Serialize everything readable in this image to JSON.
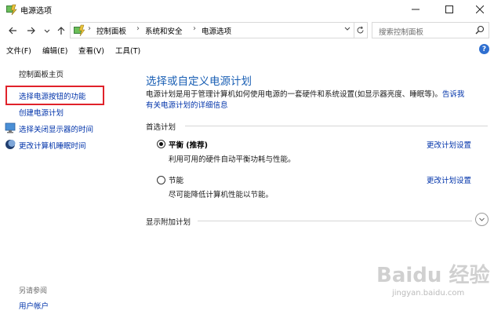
{
  "window": {
    "title": "电源选项",
    "controls": {
      "minimize": "minimize",
      "maximize": "maximize",
      "close": "close"
    }
  },
  "address": {
    "crumbs": [
      "控制面板",
      "系统和安全",
      "电源选项"
    ],
    "search_placeholder": "搜索控制面板"
  },
  "menubar": {
    "items": [
      "文件(F)",
      "编辑(E)",
      "查看(V)",
      "工具(T)"
    ]
  },
  "sidebar": {
    "home": "控制面板主页",
    "items": [
      {
        "label": "选择电源按钮的功能",
        "icon": "none",
        "highlighted": true
      },
      {
        "label": "创建电源计划",
        "icon": "none"
      },
      {
        "label": "选择关闭显示器的时间",
        "icon": "monitor-icon"
      },
      {
        "label": "更改计算机睡眠时间",
        "icon": "moon-icon"
      }
    ],
    "see_also": "另请参阅",
    "see_also_link": "用户帐户"
  },
  "main": {
    "title": "选择或自定义电源计划",
    "description_line1": "电源计划是用于管理计算机如何使用电源的一套硬件和系统设置(如显示器亮度、睡眠等)。",
    "description_link_part1": "告诉我",
    "description_link_part2": "有关电源计划的详细信息",
    "preferred_header": "首选计划",
    "plans": [
      {
        "name": "平衡 (推荐)",
        "desc": "利用可用的硬件自动平衡功耗与性能。",
        "selected": true,
        "link": "更改计划设置"
      },
      {
        "name": "节能",
        "desc": "尽可能降低计算机性能以节能。",
        "selected": false,
        "link": "更改计划设置"
      }
    ],
    "additional_header": "显示附加计划"
  },
  "watermark": {
    "text": "Baidu 经验",
    "sub": "jingyan.baidu.com"
  },
  "colors": {
    "link": "#0033aa",
    "title": "#1a5fb4",
    "highlight_border": "#e0222a"
  }
}
